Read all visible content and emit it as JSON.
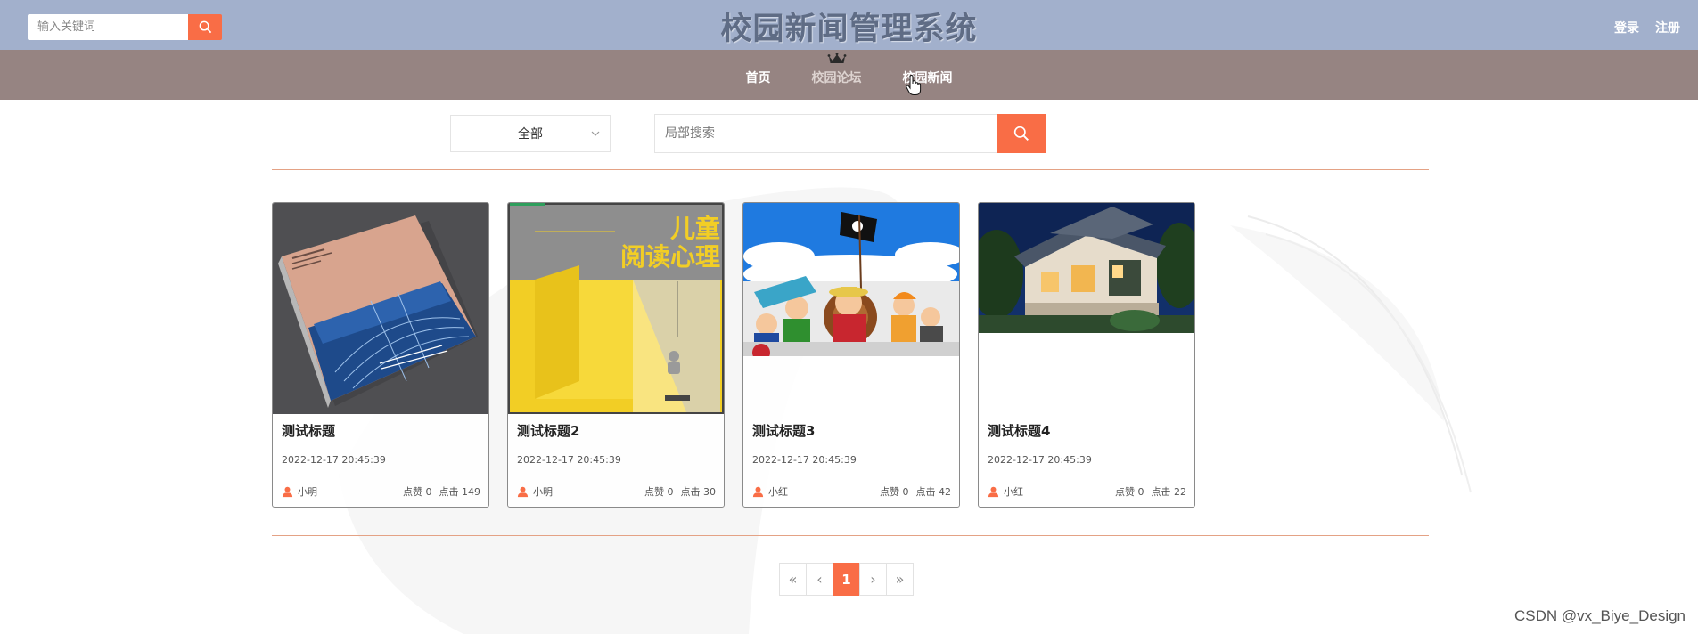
{
  "header": {
    "search_placeholder": "输入关键词",
    "title": "校园新闻管理系统",
    "login": "登录",
    "register": "注册"
  },
  "nav": {
    "items": [
      {
        "label": "首页",
        "active": false
      },
      {
        "label": "校园论坛",
        "active": true
      },
      {
        "label": "校园新闻",
        "active": false
      }
    ]
  },
  "filter": {
    "category": "全部",
    "search_placeholder": "局部搜索"
  },
  "cards": [
    {
      "title": "测试标题",
      "time": "2022-12-17 20:45:39",
      "author": "小明",
      "likes": "点赞 0",
      "clicks": "点击 149"
    },
    {
      "title": "测试标题2",
      "time": "2022-12-17 20:45:39",
      "author": "小明",
      "likes": "点赞 0",
      "clicks": "点击 30"
    },
    {
      "title": "测试标题3",
      "time": "2022-12-17 20:45:39",
      "author": "小红",
      "likes": "点赞 0",
      "clicks": "点击 42"
    },
    {
      "title": "测试标题4",
      "time": "2022-12-17 20:45:39",
      "author": "小红",
      "likes": "点赞 0",
      "clicks": "点击 22"
    }
  ],
  "card_images": {
    "2": {
      "title_line1": "儿童",
      "title_line2": "阅读心理"
    }
  },
  "pagination": {
    "first": "«",
    "prev": "‹",
    "current": "1",
    "next": "›",
    "last": "»"
  },
  "watermark": "CSDN @vx_Biye_Design",
  "colors": {
    "header_bg": "#a2b0cc",
    "nav_bg": "#968482",
    "accent": "#f96d46"
  }
}
